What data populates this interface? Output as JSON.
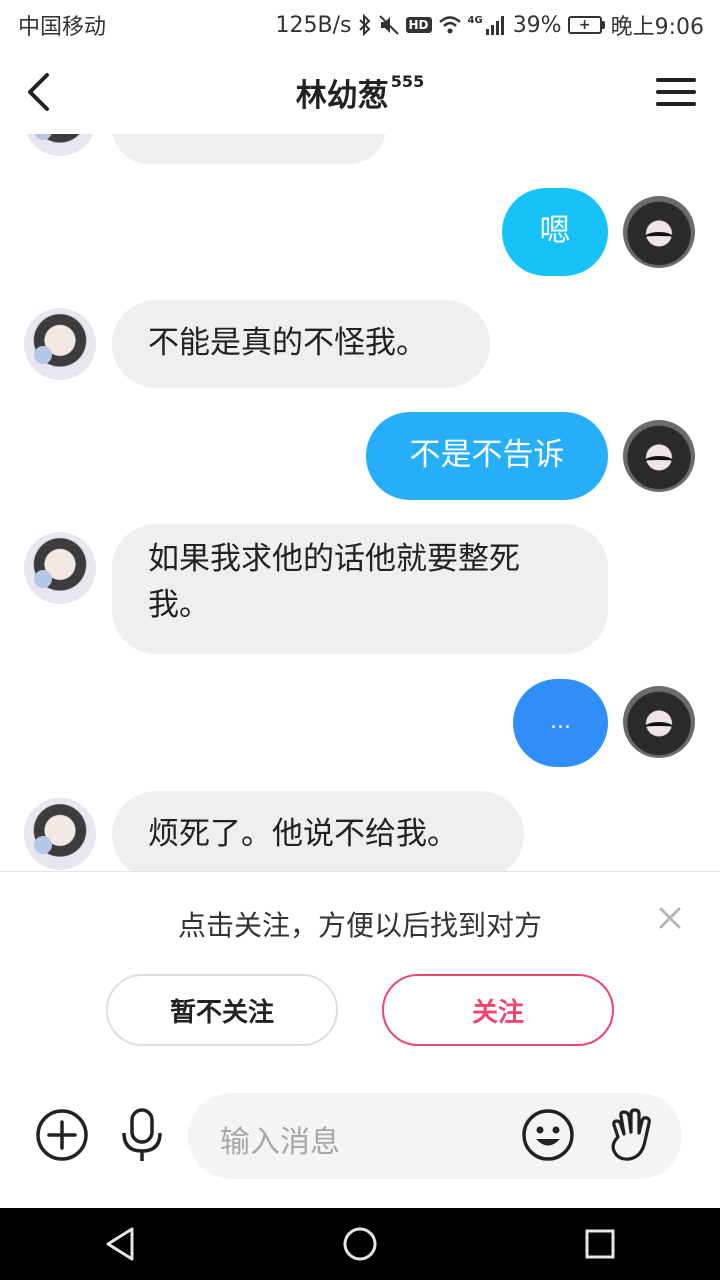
{
  "status_bar": {
    "carrier": "中国移动",
    "network_speed": "125B/s",
    "hd_label": "HD",
    "signal_type": "4G",
    "battery_percent": "39%",
    "time": "晚上9:06",
    "icons": [
      "bluetooth-icon",
      "mute-icon",
      "wifi-icon",
      "signal-icon",
      "battery-icon"
    ]
  },
  "header": {
    "title": "林幼葱",
    "title_suffix": "555"
  },
  "messages": [
    {
      "side": "out",
      "text": "嗯",
      "color": "#16C2F7"
    },
    {
      "side": "in",
      "text": "不能是真的不怪我。"
    },
    {
      "side": "out",
      "text": "不是不告诉",
      "color": "#27AEF8"
    },
    {
      "side": "in",
      "text": "如果我求他的话他就要整死我。"
    },
    {
      "side": "out",
      "text": "...",
      "color": "#2F8EF7"
    },
    {
      "side": "in",
      "text": "烦死了。他说不给我。"
    }
  ],
  "follow_prompt": {
    "text": "点击关注，方便以后找到对方",
    "decline_label": "暂不关注",
    "follow_label": "关注"
  },
  "input_bar": {
    "placeholder": "输入消息"
  },
  "colors": {
    "accent_pink": "#F0456E",
    "incoming_bubble": "#EFEFEF"
  }
}
